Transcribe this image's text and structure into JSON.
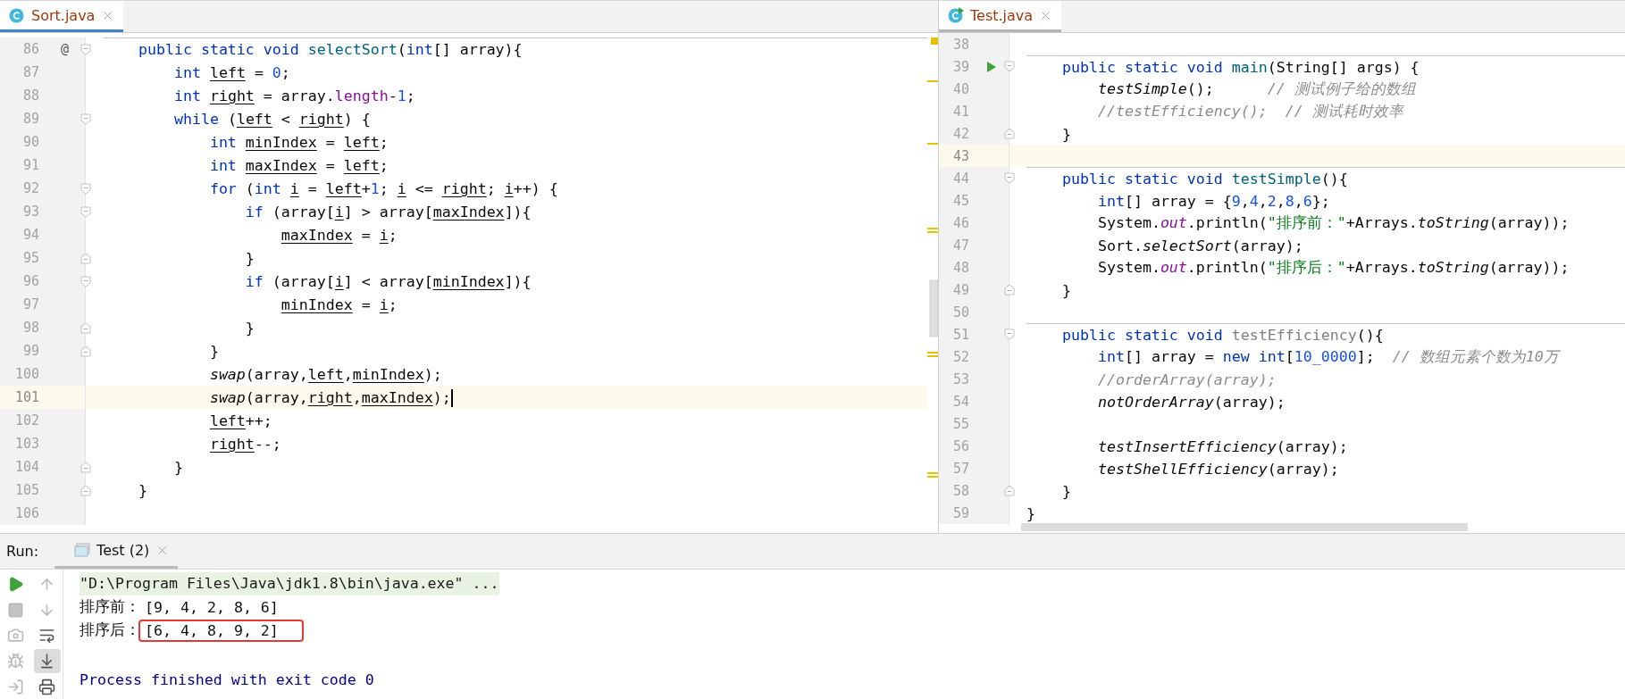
{
  "editors": [
    {
      "tab": {
        "label": "Sort.java",
        "kind": "class",
        "selected": true
      },
      "lines": [
        {
          "number": "86",
          "gutter_mark": "@",
          "fold_open": true,
          "fold_close": false,
          "separator": true,
          "current": false,
          "caret": false,
          "tokens": [
            {
              "kind": "kw",
              "text": "    public static void "
            },
            {
              "kind": "decl",
              "text": "selectSort"
            },
            {
              "kind": "plain",
              "text": "("
            },
            {
              "kind": "kw",
              "text": "int"
            },
            {
              "kind": "plain",
              "text": "[] array){"
            }
          ]
        },
        {
          "number": "87",
          "fold_open": false,
          "fold_close": false,
          "separator": false,
          "current": false,
          "caret": false,
          "tokens": [
            {
              "kind": "kw",
              "text": "        int "
            },
            {
              "kind": "var",
              "text": "left"
            },
            {
              "kind": "plain",
              "text": " = "
            },
            {
              "kind": "num",
              "text": "0"
            },
            {
              "kind": "plain",
              "text": ";"
            }
          ]
        },
        {
          "number": "88",
          "fold_open": false,
          "fold_close": false,
          "separator": false,
          "current": false,
          "caret": false,
          "tokens": [
            {
              "kind": "kw",
              "text": "        int "
            },
            {
              "kind": "var",
              "text": "right"
            },
            {
              "kind": "plain",
              "text": " = array."
            },
            {
              "kind": "field",
              "text": "length"
            },
            {
              "kind": "plain",
              "text": "-"
            },
            {
              "kind": "num",
              "text": "1"
            },
            {
              "kind": "plain",
              "text": ";"
            }
          ]
        },
        {
          "number": "89",
          "fold_open": true,
          "fold_close": false,
          "separator": false,
          "current": false,
          "caret": false,
          "tokens": [
            {
              "kind": "kw",
              "text": "        while "
            },
            {
              "kind": "plain",
              "text": "("
            },
            {
              "kind": "var",
              "text": "left"
            },
            {
              "kind": "plain",
              "text": " < "
            },
            {
              "kind": "var",
              "text": "right"
            },
            {
              "kind": "plain",
              "text": ") {"
            }
          ]
        },
        {
          "number": "90",
          "fold_open": false,
          "fold_close": false,
          "separator": false,
          "current": false,
          "caret": false,
          "tokens": [
            {
              "kind": "kw",
              "text": "            int "
            },
            {
              "kind": "var",
              "text": "minIndex"
            },
            {
              "kind": "plain",
              "text": " = "
            },
            {
              "kind": "var",
              "text": "left"
            },
            {
              "kind": "plain",
              "text": ";"
            }
          ]
        },
        {
          "number": "91",
          "fold_open": false,
          "fold_close": false,
          "separator": false,
          "current": false,
          "caret": false,
          "tokens": [
            {
              "kind": "kw",
              "text": "            int "
            },
            {
              "kind": "var",
              "text": "maxIndex"
            },
            {
              "kind": "plain",
              "text": " = "
            },
            {
              "kind": "var",
              "text": "left"
            },
            {
              "kind": "plain",
              "text": ";"
            }
          ]
        },
        {
          "number": "92",
          "fold_open": true,
          "fold_close": false,
          "separator": false,
          "current": false,
          "caret": false,
          "tokens": [
            {
              "kind": "kw",
              "text": "            for "
            },
            {
              "kind": "plain",
              "text": "("
            },
            {
              "kind": "kw",
              "text": "int "
            },
            {
              "kind": "var",
              "text": "i"
            },
            {
              "kind": "plain",
              "text": " = "
            },
            {
              "kind": "var",
              "text": "left"
            },
            {
              "kind": "plain",
              "text": "+"
            },
            {
              "kind": "num",
              "text": "1"
            },
            {
              "kind": "plain",
              "text": "; "
            },
            {
              "kind": "var",
              "text": "i"
            },
            {
              "kind": "plain",
              "text": " <= "
            },
            {
              "kind": "var",
              "text": "right"
            },
            {
              "kind": "plain",
              "text": "; "
            },
            {
              "kind": "var",
              "text": "i"
            },
            {
              "kind": "plain",
              "text": "++) {"
            }
          ]
        },
        {
          "number": "93",
          "fold_open": true,
          "fold_close": false,
          "separator": false,
          "current": false,
          "caret": false,
          "tokens": [
            {
              "kind": "kw",
              "text": "                if "
            },
            {
              "kind": "plain",
              "text": "(array["
            },
            {
              "kind": "var",
              "text": "i"
            },
            {
              "kind": "plain",
              "text": "] > array["
            },
            {
              "kind": "var",
              "text": "maxIndex"
            },
            {
              "kind": "plain",
              "text": "]){"
            }
          ]
        },
        {
          "number": "94",
          "fold_open": false,
          "fold_close": false,
          "separator": false,
          "current": false,
          "caret": false,
          "tokens": [
            {
              "kind": "var",
              "text": "                    maxIndex"
            },
            {
              "kind": "plain",
              "text": " = "
            },
            {
              "kind": "var",
              "text": "i"
            },
            {
              "kind": "plain",
              "text": ";"
            }
          ]
        },
        {
          "number": "95",
          "fold_open": false,
          "fold_close": true,
          "separator": false,
          "current": false,
          "caret": false,
          "tokens": [
            {
              "kind": "plain",
              "text": "                }"
            }
          ]
        },
        {
          "number": "96",
          "fold_open": true,
          "fold_close": false,
          "separator": false,
          "current": false,
          "caret": false,
          "tokens": [
            {
              "kind": "kw",
              "text": "                if "
            },
            {
              "kind": "plain",
              "text": "(array["
            },
            {
              "kind": "var",
              "text": "i"
            },
            {
              "kind": "plain",
              "text": "] < array["
            },
            {
              "kind": "var",
              "text": "minIndex"
            },
            {
              "kind": "plain",
              "text": "]){"
            }
          ]
        },
        {
          "number": "97",
          "fold_open": false,
          "fold_close": false,
          "separator": false,
          "current": false,
          "caret": false,
          "tokens": [
            {
              "kind": "var",
              "text": "                    minIndex"
            },
            {
              "kind": "plain",
              "text": " = "
            },
            {
              "kind": "var",
              "text": "i"
            },
            {
              "kind": "plain",
              "text": ";"
            }
          ]
        },
        {
          "number": "98",
          "fold_open": false,
          "fold_close": true,
          "separator": false,
          "current": false,
          "caret": false,
          "tokens": [
            {
              "kind": "plain",
              "text": "                }"
            }
          ]
        },
        {
          "number": "99",
          "fold_open": false,
          "fold_close": true,
          "separator": false,
          "current": false,
          "caret": false,
          "tokens": [
            {
              "kind": "plain",
              "text": "            }"
            }
          ]
        },
        {
          "number": "100",
          "fold_open": false,
          "fold_close": false,
          "separator": false,
          "current": false,
          "caret": false,
          "tokens": [
            {
              "kind": "call",
              "text": "            swap"
            },
            {
              "kind": "plain",
              "text": "(array,"
            },
            {
              "kind": "var",
              "text": "left"
            },
            {
              "kind": "plain",
              "text": ","
            },
            {
              "kind": "var",
              "text": "minIndex"
            },
            {
              "kind": "plain",
              "text": ");"
            }
          ]
        },
        {
          "number": "101",
          "fold_open": false,
          "fold_close": false,
          "separator": false,
          "current": true,
          "caret": true,
          "tokens": [
            {
              "kind": "call",
              "text": "            swap"
            },
            {
              "kind": "plain",
              "text": "(array,"
            },
            {
              "kind": "var",
              "text": "right"
            },
            {
              "kind": "plain",
              "text": ","
            },
            {
              "kind": "var",
              "text": "maxIndex"
            },
            {
              "kind": "plain",
              "text": ");"
            }
          ]
        },
        {
          "number": "102",
          "fold_open": false,
          "fold_close": false,
          "separator": false,
          "current": false,
          "caret": false,
          "tokens": [
            {
              "kind": "var",
              "text": "            left"
            },
            {
              "kind": "plain",
              "text": "++;"
            }
          ]
        },
        {
          "number": "103",
          "fold_open": false,
          "fold_close": false,
          "separator": false,
          "current": false,
          "caret": false,
          "tokens": [
            {
              "kind": "var",
              "text": "            right"
            },
            {
              "kind": "plain",
              "text": "--;"
            }
          ]
        },
        {
          "number": "104",
          "fold_open": false,
          "fold_close": true,
          "separator": false,
          "current": false,
          "caret": false,
          "tokens": [
            {
              "kind": "plain",
              "text": "        }"
            }
          ]
        },
        {
          "number": "105",
          "fold_open": false,
          "fold_close": true,
          "separator": false,
          "current": false,
          "caret": false,
          "tokens": [
            {
              "kind": "plain",
              "text": "    }"
            }
          ]
        },
        {
          "number": "106"
        }
      ]
    },
    {
      "tab": {
        "label": "Test.java",
        "kind": "runnable-class",
        "selected": false
      },
      "lines": [
        {
          "number": "38"
        },
        {
          "number": "39",
          "fold_open": true,
          "fold_close": false,
          "separator": true,
          "current": false,
          "run": true,
          "tokens": [
            {
              "kind": "kw",
              "text": "    public static void "
            },
            {
              "kind": "decl",
              "text": "main"
            },
            {
              "kind": "plain",
              "text": "(String[] args) {"
            }
          ]
        },
        {
          "number": "40",
          "fold_open": false,
          "fold_close": false,
          "separator": false,
          "current": false,
          "run": false,
          "tokens": [
            {
              "kind": "call",
              "text": "        testSimple"
            },
            {
              "kind": "plain",
              "text": "();      "
            },
            {
              "kind": "comment",
              "text": "// 测试例子给的数组"
            }
          ]
        },
        {
          "number": "41",
          "fold_open": false,
          "fold_close": false,
          "separator": false,
          "current": false,
          "run": false,
          "tokens": [
            {
              "kind": "comment",
              "text": "        //testEfficiency();  // 测试耗时效率"
            }
          ]
        },
        {
          "number": "42",
          "fold_open": false,
          "fold_close": true,
          "separator": false,
          "current": false,
          "run": false,
          "tokens": [
            {
              "kind": "plain",
              "text": "    }"
            }
          ]
        },
        {
          "number": "43",
          "fold_open": false,
          "fold_close": false,
          "separator": false,
          "current": true,
          "run": false
        },
        {
          "number": "44",
          "fold_open": true,
          "fold_close": false,
          "separator": true,
          "current": false,
          "run": false,
          "tokens": [
            {
              "kind": "kw",
              "text": "    public static void "
            },
            {
              "kind": "decl",
              "text": "testSimple"
            },
            {
              "kind": "plain",
              "text": "(){"
            }
          ]
        },
        {
          "number": "45",
          "fold_open": false,
          "fold_close": false,
          "separator": false,
          "current": false,
          "run": false,
          "tokens": [
            {
              "kind": "kw",
              "text": "        int"
            },
            {
              "kind": "plain",
              "text": "[] array = {"
            },
            {
              "kind": "num",
              "text": "9"
            },
            {
              "kind": "plain",
              "text": ","
            },
            {
              "kind": "num",
              "text": "4"
            },
            {
              "kind": "plain",
              "text": ","
            },
            {
              "kind": "num",
              "text": "2"
            },
            {
              "kind": "plain",
              "text": ","
            },
            {
              "kind": "num",
              "text": "8"
            },
            {
              "kind": "plain",
              "text": ","
            },
            {
              "kind": "num",
              "text": "6"
            },
            {
              "kind": "plain",
              "text": "};"
            }
          ]
        },
        {
          "number": "46",
          "fold_open": false,
          "fold_close": false,
          "separator": false,
          "current": false,
          "run": false,
          "tokens": [
            {
              "kind": "plain",
              "text": "        System."
            },
            {
              "kind": "sfield",
              "text": "out"
            },
            {
              "kind": "plain",
              "text": ".println("
            },
            {
              "kind": "str",
              "text": "\"排序前：\""
            },
            {
              "kind": "plain",
              "text": "+Arrays."
            },
            {
              "kind": "call",
              "text": "toString"
            },
            {
              "kind": "plain",
              "text": "(array));"
            }
          ]
        },
        {
          "number": "47",
          "fold_open": false,
          "fold_close": false,
          "separator": false,
          "current": false,
          "run": false,
          "tokens": [
            {
              "kind": "plain",
              "text": "        Sort."
            },
            {
              "kind": "call",
              "text": "selectSort"
            },
            {
              "kind": "plain",
              "text": "(array);"
            }
          ]
        },
        {
          "number": "48",
          "fold_open": false,
          "fold_close": false,
          "separator": false,
          "current": false,
          "run": false,
          "tokens": [
            {
              "kind": "plain",
              "text": "        System."
            },
            {
              "kind": "sfield",
              "text": "out"
            },
            {
              "kind": "plain",
              "text": ".println("
            },
            {
              "kind": "str",
              "text": "\"排序后：\""
            },
            {
              "kind": "plain",
              "text": "+Arrays."
            },
            {
              "kind": "call",
              "text": "toString"
            },
            {
              "kind": "plain",
              "text": "(array));"
            }
          ]
        },
        {
          "number": "49",
          "fold_open": false,
          "fold_close": true,
          "separator": false,
          "current": false,
          "run": false,
          "tokens": [
            {
              "kind": "plain",
              "text": "    }"
            }
          ]
        },
        {
          "number": "50"
        },
        {
          "number": "51",
          "fold_open": true,
          "fold_close": false,
          "separator": true,
          "current": false,
          "run": false,
          "tokens": [
            {
              "kind": "kw",
              "text": "    public static void "
            },
            {
              "kind": "unused",
              "text": "testEfficiency"
            },
            {
              "kind": "plain",
              "text": "(){"
            }
          ]
        },
        {
          "number": "52",
          "fold_open": false,
          "fold_close": false,
          "separator": false,
          "current": false,
          "run": false,
          "tokens": [
            {
              "kind": "kw",
              "text": "        int"
            },
            {
              "kind": "plain",
              "text": "[] array = "
            },
            {
              "kind": "kw",
              "text": "new int"
            },
            {
              "kind": "plain",
              "text": "["
            },
            {
              "kind": "num",
              "text": "10_0000"
            },
            {
              "kind": "plain",
              "text": "];  "
            },
            {
              "kind": "comment",
              "text": "// 数组元素个数为10万"
            }
          ]
        },
        {
          "number": "53",
          "fold_open": false,
          "fold_close": false,
          "separator": false,
          "current": false,
          "run": false,
          "tokens": [
            {
              "kind": "comment",
              "text": "        //orderArray(array);"
            }
          ]
        },
        {
          "number": "54",
          "fold_open": false,
          "fold_close": false,
          "separator": false,
          "current": false,
          "run": false,
          "tokens": [
            {
              "kind": "call",
              "text": "        notOrderArray"
            },
            {
              "kind": "plain",
              "text": "(array);"
            }
          ]
        },
        {
          "number": "55"
        },
        {
          "number": "56",
          "fold_open": false,
          "fold_close": false,
          "separator": false,
          "current": false,
          "run": false,
          "tokens": [
            {
              "kind": "call",
              "text": "        testInsertEfficiency"
            },
            {
              "kind": "plain",
              "text": "(array);"
            }
          ]
        },
        {
          "number": "57",
          "fold_open": false,
          "fold_close": false,
          "separator": false,
          "current": false,
          "run": false,
          "tokens": [
            {
              "kind": "call",
              "text": "        testShellEfficiency"
            },
            {
              "kind": "plain",
              "text": "(array);"
            }
          ]
        },
        {
          "number": "58",
          "fold_open": false,
          "fold_close": true,
          "separator": false,
          "current": false,
          "run": false,
          "tokens": [
            {
              "kind": "plain",
              "text": "    }"
            }
          ]
        },
        {
          "number": "59",
          "fold_open": false,
          "fold_close": false,
          "separator": false,
          "current": false,
          "run": false,
          "tokens": [
            {
              "kind": "plain",
              "text": "}"
            }
          ]
        }
      ]
    }
  ],
  "run_panel": {
    "title": "Run:",
    "tab": {
      "label": "Test (2)",
      "selected": true
    },
    "left_toolbar": [
      {
        "kind": "run",
        "disabled": false
      },
      {
        "kind": "stop",
        "disabled": true
      },
      {
        "kind": "camera",
        "disabled": true
      },
      {
        "kind": "debug",
        "disabled": true
      },
      {
        "kind": "import",
        "disabled": true
      }
    ],
    "right_toolbar": [
      {
        "kind": "up",
        "disabled": true,
        "selected": false
      },
      {
        "kind": "down",
        "disabled": true,
        "selected": false
      },
      {
        "kind": "wrap",
        "disabled": false,
        "selected": false
      },
      {
        "kind": "scroll-end",
        "disabled": false,
        "selected": true
      },
      {
        "kind": "print",
        "disabled": false,
        "selected": false
      }
    ],
    "console": [
      {
        "kind": "command",
        "text": "\"D:\\Program Files\\Java\\jdk1.8\\bin\\java.exe\" ..."
      },
      {
        "kind": "output",
        "prefix": "排序前：",
        "text": "[9, 4, 2, 8, 6]",
        "highlighted": false
      },
      {
        "kind": "output",
        "prefix": "排序后：",
        "text": "[6, 4, 8, 9, 2]",
        "highlighted": true
      },
      {
        "kind": "blank"
      },
      {
        "kind": "exit",
        "text": "Process finished with exit code 0"
      }
    ]
  }
}
